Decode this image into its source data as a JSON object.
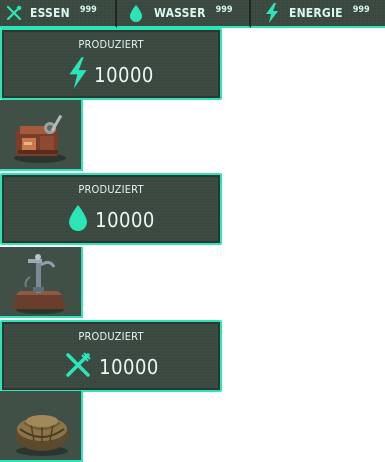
{
  "resources": [
    {
      "icon": "fork-knife-icon",
      "label": "ESSEN",
      "count": "999"
    },
    {
      "icon": "water-drop-icon",
      "label": "WASSER",
      "count": "999"
    },
    {
      "icon": "lightning-icon",
      "label": "ENERGIE",
      "count": "999"
    }
  ],
  "rooms": [
    {
      "title": "PRODUZIERT",
      "icon": "lightning-icon",
      "value": "10000",
      "thumbnail": "power-generator"
    },
    {
      "title": "PRODUZIERT",
      "icon": "water-drop-icon",
      "value": "10000",
      "thumbnail": "water-pump"
    },
    {
      "title": "PRODUZIERT",
      "icon": "fork-knife-icon",
      "value": "10000",
      "thumbnail": "food-basket"
    }
  ],
  "colors": {
    "accent": "#2ce5b7",
    "panel": "#3b4a40",
    "text": "#e3f5ef"
  }
}
